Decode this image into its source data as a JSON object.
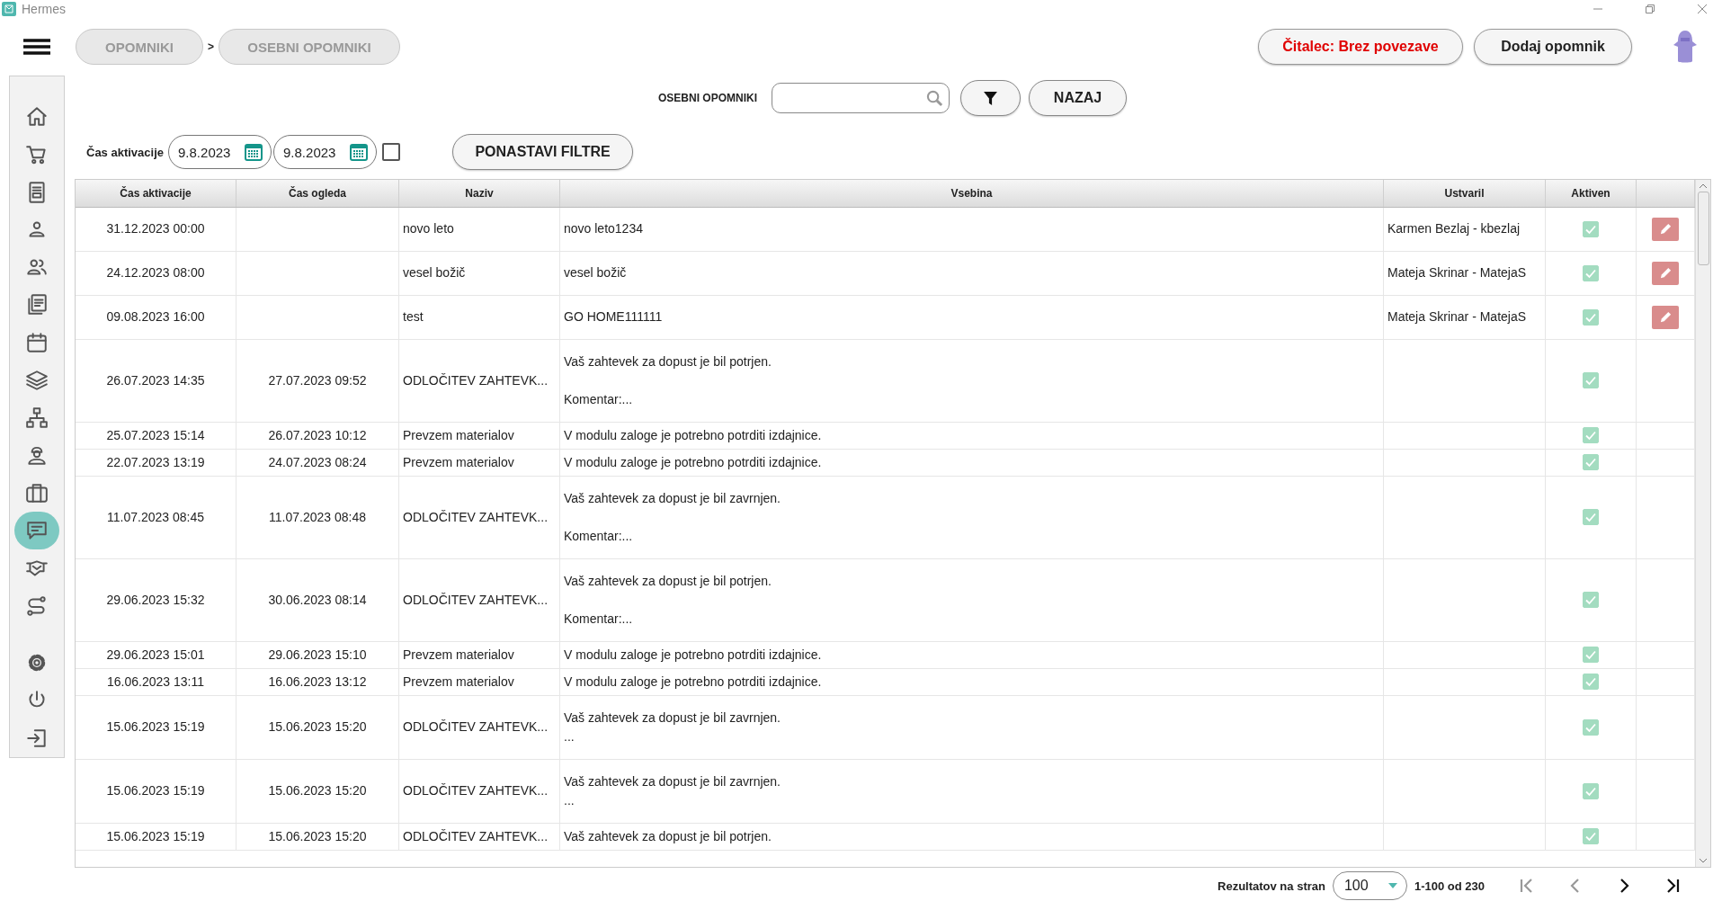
{
  "window": {
    "title": "Hermes"
  },
  "breadcrumbs": [
    {
      "label": "OPOMNIKI"
    },
    {
      "label": "OSEBNI OPOMNIKI"
    }
  ],
  "breadcrumb_separator": ">",
  "header_buttons": [
    {
      "label": "Čitalec: Brez povezave",
      "kind": "status"
    },
    {
      "label": "Dodaj opomnik",
      "kind": "action"
    }
  ],
  "sidebar": {
    "items": [
      {
        "selected": false
      },
      {
        "selected": false
      },
      {
        "selected": false
      },
      {
        "selected": false
      },
      {
        "selected": false
      },
      {
        "selected": false
      },
      {
        "selected": false
      },
      {
        "selected": false
      },
      {
        "selected": false
      },
      {
        "selected": false
      },
      {
        "selected": false
      },
      {
        "selected": true
      },
      {
        "selected": false
      },
      {
        "selected": false
      },
      {
        "selected": false
      },
      {
        "selected": false
      },
      {
        "selected": false
      }
    ]
  },
  "search": {
    "label": "OSEBNI OPOMNIKI",
    "back_button": "NAZAJ"
  },
  "filters": {
    "label": "Čas aktivacije",
    "date_from": "9.8.2023",
    "date_to": "9.8.2023",
    "checked": false,
    "reset_button": "PONASTAVI FILTRE"
  },
  "table": {
    "columns": [
      "Čas aktivacije",
      "Čas ogleda",
      "Naziv",
      "Vsebina",
      "Ustvaril",
      "Aktiven"
    ],
    "rows": [
      {
        "activation_time": "31.12.2023 00:00",
        "name": "novo leto",
        "content": "novo leto1234",
        "created_by": "Karmen Bezlaj - kbezlaj",
        "active": true,
        "editable": true
      },
      {
        "activation_time": "24.12.2023 08:00",
        "name": "vesel božič",
        "content": "vesel božič",
        "created_by": "Mateja Skrinar - MatejaS",
        "active": true,
        "editable": true
      },
      {
        "activation_time": "09.08.2023 16:00",
        "name": "test",
        "content": "GO HOME111111",
        "created_by": "Mateja Skrinar - MatejaS",
        "active": true,
        "editable": true
      },
      {
        "activation_time": "26.07.2023 14:35",
        "view_time": "27.07.2023 09:52",
        "name": "ODLOČITEV ZAHTEVK...",
        "content": "Vaš zahtevek za dopust je bil potrjen.\n\nKomentar:...",
        "active": true,
        "editable": false
      },
      {
        "activation_time": "25.07.2023 15:14",
        "view_time": "26.07.2023 10:12",
        "name": "Prevzem materialov",
        "content": "V modulu zaloge je potrebno potrditi izdajnice.",
        "active": true,
        "editable": false
      },
      {
        "activation_time": "22.07.2023 13:19",
        "view_time": "24.07.2023 08:24",
        "name": "Prevzem materialov",
        "content": "V modulu zaloge je potrebno potrditi izdajnice.",
        "active": true,
        "editable": false
      },
      {
        "activation_time": "11.07.2023 08:45",
        "view_time": "11.07.2023 08:48",
        "name": "ODLOČITEV ZAHTEVK...",
        "content": "Vaš zahtevek za dopust je bil zavrnjen.\n\nKomentar:...",
        "active": true,
        "editable": false
      },
      {
        "activation_time": "29.06.2023 15:32",
        "view_time": "30.06.2023 08:14",
        "name": "ODLOČITEV ZAHTEVK...",
        "content": "Vaš zahtevek za dopust je bil potrjen.\n\nKomentar:...",
        "active": true,
        "editable": false
      },
      {
        "activation_time": "29.06.2023 15:01",
        "view_time": "29.06.2023 15:10",
        "name": "Prevzem materialov",
        "content": "V modulu zaloge je potrebno potrditi izdajnice.",
        "active": true,
        "editable": false
      },
      {
        "activation_time": "16.06.2023 13:11",
        "view_time": "16.06.2023 13:12",
        "name": "Prevzem materialov",
        "content": "V modulu zaloge je potrebno potrditi izdajnice.",
        "active": true,
        "editable": false
      },
      {
        "activation_time": "15.06.2023 15:19",
        "view_time": "15.06.2023 15:20",
        "name": "ODLOČITEV ZAHTEVK...",
        "content": "Vaš zahtevek za dopust je bil zavrnjen.\n...",
        "active": true,
        "editable": false
      },
      {
        "activation_time": "15.06.2023 15:19",
        "view_time": "15.06.2023 15:20",
        "name": "ODLOČITEV ZAHTEVK...",
        "content": "Vaš zahtevek za dopust je bil zavrnjen.\n...",
        "active": true,
        "editable": false
      },
      {
        "activation_time": "15.06.2023 15:19",
        "view_time": "15.06.2023 15:20",
        "name": "ODLOČITEV ZAHTEVK...",
        "content": "Vaš zahtevek za dopust je bil potrjen.",
        "active": true,
        "editable": false
      }
    ]
  },
  "pagination": {
    "label": "Rezultatov na stran",
    "page_size": "100",
    "range": "1-100 od 230",
    "first_disabled": true,
    "prev_disabled": true,
    "next_disabled": false,
    "last_disabled": false
  }
}
